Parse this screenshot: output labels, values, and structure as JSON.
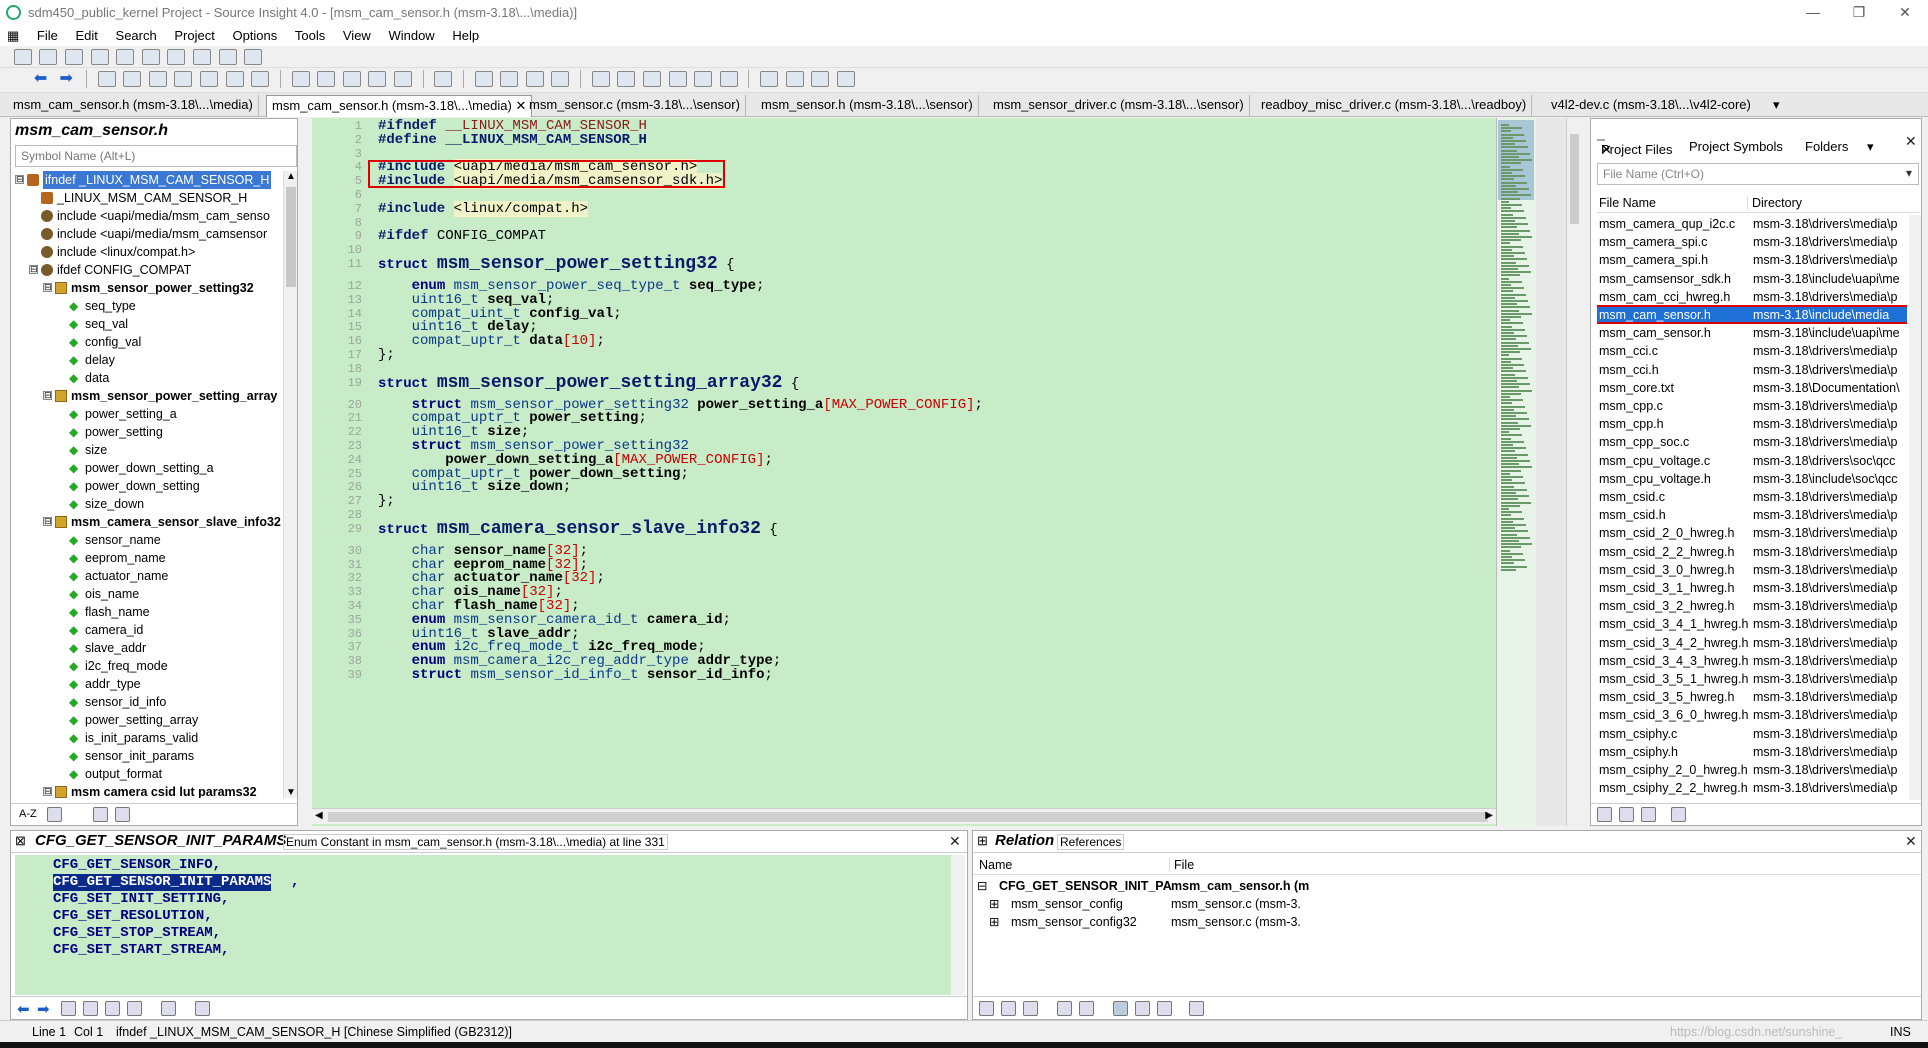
{
  "window": {
    "title": "sdm450_public_kernel Project - Source Insight 4.0 - [msm_cam_sensor.h (msm-3.18\\...\\media)]",
    "minimize_glyph": "—",
    "restore_glyph": "❐",
    "close_glyph": "✕"
  },
  "menu": [
    "File",
    "Edit",
    "Search",
    "Project",
    "Options",
    "Tools",
    "View",
    "Window",
    "Help"
  ],
  "tabs": [
    "msm_cam_sensor.h (msm-3.18\\...\\media)",
    "msm_cam_sensor.h (msm-3.18\\...\\media)",
    "msm_sensor.c (msm-3.18\\...\\sensor)",
    "msm_sensor.h (msm-3.18\\...\\sensor)",
    "msm_sensor_driver.c (msm-3.18\\...\\sensor)",
    "readboy_misc_driver.c (msm-3.18\\...\\readboy)",
    "v4l2-dev.c (msm-3.18\\...\\v4l2-core)"
  ],
  "tab_close_glyph": "✕",
  "tab_overflow_glyph": "▾",
  "symbol_window": {
    "title": "msm_cam_sensor.h",
    "search_placeholder": "Symbol Name (Alt+L)",
    "items": [
      {
        "label": "ifndef _LINUX_MSM_CAM_SENSOR_H",
        "kind": "def",
        "level": 0,
        "expander": "⊟",
        "selected": true
      },
      {
        "label": "_LINUX_MSM_CAM_SENSOR_H",
        "kind": "def",
        "level": 1
      },
      {
        "label": "include <uapi/media/msm_cam_senso",
        "kind": "inc",
        "level": 1
      },
      {
        "label": "include <uapi/media/msm_camsensor",
        "kind": "inc",
        "level": 1
      },
      {
        "label": "include <linux/compat.h>",
        "kind": "inc",
        "level": 1
      },
      {
        "label": "ifdef CONFIG_COMPAT",
        "kind": "inc",
        "level": 1,
        "expander": "⊟"
      },
      {
        "label": "msm_sensor_power_setting32",
        "kind": "struct",
        "level": 2,
        "expander": "⊟",
        "bold": true
      },
      {
        "label": "seq_type",
        "kind": "mem",
        "level": 3
      },
      {
        "label": "seq_val",
        "kind": "mem",
        "level": 3
      },
      {
        "label": "config_val",
        "kind": "mem",
        "level": 3
      },
      {
        "label": "delay",
        "kind": "mem",
        "level": 3
      },
      {
        "label": "data",
        "kind": "mem",
        "level": 3
      },
      {
        "label": "msm_sensor_power_setting_array",
        "kind": "struct",
        "level": 2,
        "expander": "⊟",
        "bold": true
      },
      {
        "label": "power_setting_a",
        "kind": "mem",
        "level": 3
      },
      {
        "label": "power_setting",
        "kind": "mem",
        "level": 3
      },
      {
        "label": "size",
        "kind": "mem",
        "level": 3
      },
      {
        "label": "power_down_setting_a",
        "kind": "mem",
        "level": 3
      },
      {
        "label": "power_down_setting",
        "kind": "mem",
        "level": 3
      },
      {
        "label": "size_down",
        "kind": "mem",
        "level": 3
      },
      {
        "label": "msm_camera_sensor_slave_info32",
        "kind": "struct",
        "level": 2,
        "expander": "⊟",
        "bold": true
      },
      {
        "label": "sensor_name",
        "kind": "mem",
        "level": 3
      },
      {
        "label": "eeprom_name",
        "kind": "mem",
        "level": 3
      },
      {
        "label": "actuator_name",
        "kind": "mem",
        "level": 3
      },
      {
        "label": "ois_name",
        "kind": "mem",
        "level": 3
      },
      {
        "label": "flash_name",
        "kind": "mem",
        "level": 3
      },
      {
        "label": "camera_id",
        "kind": "mem",
        "level": 3
      },
      {
        "label": "slave_addr",
        "kind": "mem",
        "level": 3
      },
      {
        "label": "i2c_freq_mode",
        "kind": "mem",
        "level": 3
      },
      {
        "label": "addr_type",
        "kind": "mem",
        "level": 3
      },
      {
        "label": "sensor_id_info",
        "kind": "mem",
        "level": 3
      },
      {
        "label": "power_setting_array",
        "kind": "mem",
        "level": 3
      },
      {
        "label": "is_init_params_valid",
        "kind": "mem",
        "level": 3
      },
      {
        "label": "sensor_init_params",
        "kind": "mem",
        "level": 3
      },
      {
        "label": "output_format",
        "kind": "mem",
        "level": 3
      },
      {
        "label": "msm camera csid lut params32",
        "kind": "struct",
        "level": 2,
        "expander": "⊟",
        "bold": true
      }
    ],
    "bottom_az": "A-Z",
    "scroll_up": "▲",
    "scroll_down": "▼"
  },
  "code": {
    "lines": [
      {
        "n": "1",
        "html": "<span class='pp'>#ifndef</span> <span class='mac'>__LINUX_MSM_CAM_SENSOR_H</span>"
      },
      {
        "n": "2",
        "html": "<span class='pp'>#define</span> <span class='pp'>__LINUX_MSM_CAM_SENSOR_H</span>"
      },
      {
        "n": "3",
        "html": ""
      },
      {
        "n": "4",
        "html": "<span class='pp'>#include</span> <span class='hdr'>&lt;uapi/media/msm_cam_sensor.h&gt;</span>"
      },
      {
        "n": "5",
        "html": "<span class='pp'>#include</span> <span class='hdr'>&lt;uapi/media/msm_camsensor_sdk.h&gt;</span>"
      },
      {
        "n": "6",
        "html": ""
      },
      {
        "n": "7",
        "html": "<span class='pp'>#include</span> <span class='hdr'>&lt;linux/compat.h&gt;</span>"
      },
      {
        "n": "8",
        "html": ""
      },
      {
        "n": "9",
        "html": "<span class='pp'>#ifdef</span> CONFIG_COMPAT"
      },
      {
        "n": "10",
        "html": ""
      },
      {
        "n": "11",
        "html": "<span class='kw'>struct</span> <span class='big'>msm_sensor_power_setting32</span> {"
      },
      {
        "n": "12",
        "html": "    <span class='kw'>enum</span> <span class='ty'>msm_sensor_power_seq_type_t</span> <span class='fld'>seq_type</span>;"
      },
      {
        "n": "13",
        "html": "    <span class='ty'>uint16_t</span> <span class='fld'>seq_val</span>;"
      },
      {
        "n": "14",
        "html": "    <span class='ty'>compat_uint_t</span> <span class='fld'>config_val</span>;"
      },
      {
        "n": "15",
        "html": "    <span class='ty'>uint16_t</span> <span class='fld'>delay</span>;"
      },
      {
        "n": "16",
        "html": "    <span class='ty'>compat_uptr_t</span> <span class='fld'>data</span><span class='num'>[10]</span>;"
      },
      {
        "n": "17",
        "html": "};"
      },
      {
        "n": "18",
        "html": ""
      },
      {
        "n": "19",
        "html": "<span class='kw'>struct</span> <span class='big'>msm_sensor_power_setting_array32</span> {"
      },
      {
        "n": "20",
        "html": "    <span class='kw'>struct</span> <span class='ty'>msm_sensor_power_setting32</span> <span class='fld'>power_setting_a</span><span class='num'>[MAX_POWER_CONFIG]</span>;"
      },
      {
        "n": "21",
        "html": "    <span class='ty'>compat_uptr_t</span> <span class='fld'>power_setting</span>;"
      },
      {
        "n": "22",
        "html": "    <span class='ty'>uint16_t</span> <span class='fld'>size</span>;"
      },
      {
        "n": "23",
        "html": "    <span class='kw'>struct</span> <span class='ty'>msm_sensor_power_setting32</span>"
      },
      {
        "n": "24",
        "html": "        <span class='fld'>power_down_setting_a</span><span class='num'>[MAX_POWER_CONFIG]</span>;"
      },
      {
        "n": "25",
        "html": "    <span class='ty'>compat_uptr_t</span> <span class='fld'>power_down_setting</span>;"
      },
      {
        "n": "26",
        "html": "    <span class='ty'>uint16_t</span> <span class='fld'>size_down</span>;"
      },
      {
        "n": "27",
        "html": "};"
      },
      {
        "n": "28",
        "html": ""
      },
      {
        "n": "29",
        "html": "<span class='kw'>struct</span> <span class='big'>msm_camera_sensor_slave_info32</span> {"
      },
      {
        "n": "30",
        "html": "    <span class='ty'>char</span> <span class='fld'>sensor_name</span><span class='num'>[32]</span>;"
      },
      {
        "n": "31",
        "html": "    <span class='ty'>char</span> <span class='fld'>eeprom_name</span><span class='num'>[32]</span>;"
      },
      {
        "n": "32",
        "html": "    <span class='ty'>char</span> <span class='fld'>actuator_name</span><span class='num'>[32]</span>;"
      },
      {
        "n": "33",
        "html": "    <span class='ty'>char</span> <span class='fld'>ois_name</span><span class='num'>[32]</span>;"
      },
      {
        "n": "34",
        "html": "    <span class='ty'>char</span> <span class='fld'>flash_name</span><span class='num'>[32]</span>;"
      },
      {
        "n": "35",
        "html": "    <span class='kw'>enum</span> <span class='ty'>msm_sensor_camera_id_t</span> <span class='fld'>camera_id</span>;"
      },
      {
        "n": "36",
        "html": "    <span class='ty'>uint16_t</span> <span class='fld'>slave_addr</span>;"
      },
      {
        "n": "37",
        "html": "    <span class='kw'>enum</span> <span class='ty'>i2c_freq_mode_t</span> <span class='fld'>i2c_freq_mode</span>;"
      },
      {
        "n": "38",
        "html": "    <span class='kw'>enum</span> <span class='ty'>msm_camera_i2c_reg_addr_type</span> <span class='fld'>addr_type</span>;"
      },
      {
        "n": "39",
        "html": "    <span class='kw'>struct</span> <span class='ty'>msm_sensor_id_info_t</span> <span class='fld'>sensor_id_info</span>;"
      }
    ],
    "scroll_left": "◀",
    "scroll_right": "▶"
  },
  "project_window": {
    "tabs": [
      "Project Files",
      "Project Symbols",
      "Folders"
    ],
    "tab_close_glyph": "✕",
    "tab_menu_glyph": "▾",
    "close_glyph": "✕",
    "filter_placeholder": "File Name (Ctrl+O)",
    "filter_dropdown_glyph": "▾",
    "columns": [
      "File Name",
      "Directory"
    ],
    "rows": [
      {
        "file": "msm_camera_qup_i2c.c",
        "dir": "msm-3.18\\drivers\\media\\p"
      },
      {
        "file": "msm_camera_spi.c",
        "dir": "msm-3.18\\drivers\\media\\p"
      },
      {
        "file": "msm_camera_spi.h",
        "dir": "msm-3.18\\drivers\\media\\p"
      },
      {
        "file": "msm_camsensor_sdk.h",
        "dir": "msm-3.18\\include\\uapi\\me"
      },
      {
        "file": "msm_cam_cci_hwreg.h",
        "dir": "msm-3.18\\drivers\\media\\p"
      },
      {
        "file": "msm_cam_sensor.h",
        "dir": "msm-3.18\\include\\media",
        "selected": true
      },
      {
        "file": "msm_cam_sensor.h",
        "dir": "msm-3.18\\include\\uapi\\me"
      },
      {
        "file": "msm_cci.c",
        "dir": "msm-3.18\\drivers\\media\\p"
      },
      {
        "file": "msm_cci.h",
        "dir": "msm-3.18\\drivers\\media\\p"
      },
      {
        "file": "msm_core.txt",
        "dir": "msm-3.18\\Documentation\\"
      },
      {
        "file": "msm_cpp.c",
        "dir": "msm-3.18\\drivers\\media\\p"
      },
      {
        "file": "msm_cpp.h",
        "dir": "msm-3.18\\drivers\\media\\p"
      },
      {
        "file": "msm_cpp_soc.c",
        "dir": "msm-3.18\\drivers\\media\\p"
      },
      {
        "file": "msm_cpu_voltage.c",
        "dir": "msm-3.18\\drivers\\soc\\qcc"
      },
      {
        "file": "msm_cpu_voltage.h",
        "dir": "msm-3.18\\include\\soc\\qcc"
      },
      {
        "file": "msm_csid.c",
        "dir": "msm-3.18\\drivers\\media\\p"
      },
      {
        "file": "msm_csid.h",
        "dir": "msm-3.18\\drivers\\media\\p"
      },
      {
        "file": "msm_csid_2_0_hwreg.h",
        "dir": "msm-3.18\\drivers\\media\\p"
      },
      {
        "file": "msm_csid_2_2_hwreg.h",
        "dir": "msm-3.18\\drivers\\media\\p"
      },
      {
        "file": "msm_csid_3_0_hwreg.h",
        "dir": "msm-3.18\\drivers\\media\\p"
      },
      {
        "file": "msm_csid_3_1_hwreg.h",
        "dir": "msm-3.18\\drivers\\media\\p"
      },
      {
        "file": "msm_csid_3_2_hwreg.h",
        "dir": "msm-3.18\\drivers\\media\\p"
      },
      {
        "file": "msm_csid_3_4_1_hwreg.h",
        "dir": "msm-3.18\\drivers\\media\\p"
      },
      {
        "file": "msm_csid_3_4_2_hwreg.h",
        "dir": "msm-3.18\\drivers\\media\\p"
      },
      {
        "file": "msm_csid_3_4_3_hwreg.h",
        "dir": "msm-3.18\\drivers\\media\\p"
      },
      {
        "file": "msm_csid_3_5_1_hwreg.h",
        "dir": "msm-3.18\\drivers\\media\\p"
      },
      {
        "file": "msm_csid_3_5_hwreg.h",
        "dir": "msm-3.18\\drivers\\media\\p"
      },
      {
        "file": "msm_csid_3_6_0_hwreg.h",
        "dir": "msm-3.18\\drivers\\media\\p"
      },
      {
        "file": "msm_csiphy.c",
        "dir": "msm-3.18\\drivers\\media\\p"
      },
      {
        "file": "msm_csiphy.h",
        "dir": "msm-3.18\\drivers\\media\\p"
      },
      {
        "file": "msm_csiphy_2_0_hwreg.h",
        "dir": "msm-3.18\\drivers\\media\\p"
      },
      {
        "file": "msm_csiphy_2_2_hwreg.h",
        "dir": "msm-3.18\\drivers\\media\\p"
      }
    ]
  },
  "context_window": {
    "symbol": "CFG_GET_SENSOR_INIT_PARAMS",
    "description": "Enum Constant in msm_cam_sensor.h (msm-3.18\\...\\media) at line 331",
    "close_glyph": "✕",
    "lines": [
      {
        "text": "CFG_GET_SENSOR_INFO,"
      },
      {
        "text": "CFG_GET_SENSOR_INIT_PARAMS",
        "suffix": ",",
        "selected": true
      },
      {
        "text": "CFG_SET_INIT_SETTING,"
      },
      {
        "text": "CFG_SET_RESOLUTION,"
      },
      {
        "text": "CFG_SET_STOP_STREAM,"
      },
      {
        "text": "CFG_SET_START_STREAM,"
      }
    ]
  },
  "relation_window": {
    "title": "Relation",
    "tab": "References",
    "close_glyph": "✕",
    "columns": [
      "Name",
      "File"
    ],
    "rows": [
      {
        "expander": "⊟",
        "name": "CFG_GET_SENSOR_INIT_PA",
        "file": "msm_cam_sensor.h (m",
        "bold": true
      },
      {
        "expander": "⊞",
        "name": "msm_sensor_config",
        "file": "msm_sensor.c (msm-3."
      },
      {
        "expander": "⊞",
        "name": "msm_sensor_config32",
        "file": "msm_sensor.c (msm-3."
      }
    ]
  },
  "status_bar": {
    "line": "Line 1",
    "col": "Col 1",
    "symbol": "ifndef _LINUX_MSM_CAM_SENSOR_H [Chinese Simplified (GB2312)]",
    "watermark": "https://blog.csdn.net/sunshine_",
    "mode": "INS"
  }
}
